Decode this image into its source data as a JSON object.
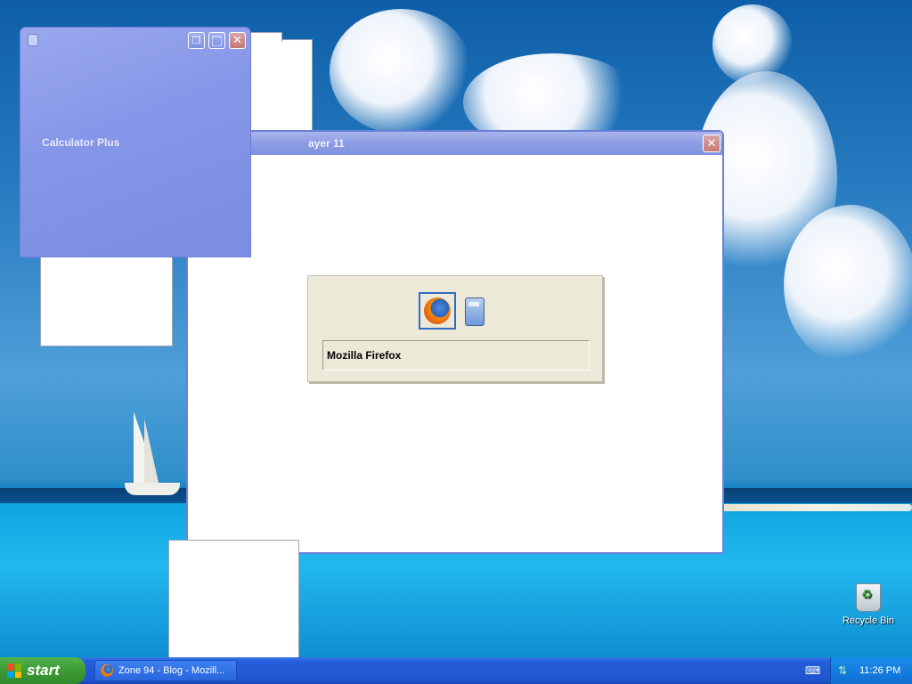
{
  "desktop": {
    "recycle_bin_label": "Recycle Bin"
  },
  "media_window": {
    "title": "ayer 11",
    "close_glyph": "✕"
  },
  "calculator_window": {
    "title": "Calculator Plus",
    "restore_glyph": "❐",
    "close_glyph": "✕"
  },
  "alt_tab": {
    "items": [
      {
        "icon": "firefox-icon",
        "name": "Mozilla Firefox",
        "selected": true
      },
      {
        "icon": "calculator-icon",
        "name": "Calculator Plus",
        "selected": false
      }
    ],
    "selected_label": "Mozilla Firefox"
  },
  "taskbar": {
    "start_label": "start",
    "tasks": [
      {
        "icon": "firefox-icon",
        "label": "Zone 94 - Blog - Mozill..."
      }
    ],
    "keyboard_icon": "⌨",
    "network_icon": "network-icon",
    "clock": "11:26 PM"
  },
  "colors": {
    "window_title_inactive": "#8d9de4",
    "taskbar": "#245edb",
    "start_button": "#3c9a35",
    "alt_tab_bg": "#ece9d8",
    "selection_border": "#316ac5"
  }
}
